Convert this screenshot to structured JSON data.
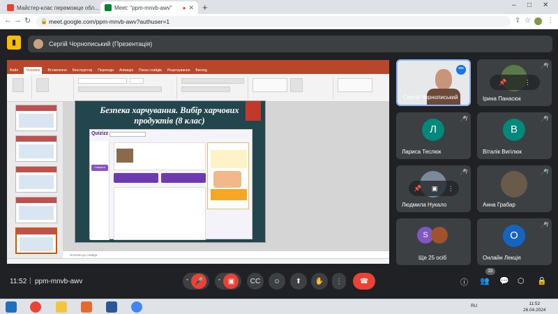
{
  "browser": {
    "tabs": [
      {
        "title": "Майстер-клас переможце обл...",
        "favicon_color": "#ea4335"
      },
      {
        "title": "Meet: \"ppm-mnvb-awv\"",
        "favicon_color": "#00832d",
        "active": true
      }
    ],
    "url": "meet.google.com/ppm-mnvb-awv?authuser=1",
    "window_controls": [
      "–",
      "□",
      "✕"
    ]
  },
  "meet": {
    "presenter_label": "Сергій Чорнописький (Презентація)",
    "clock": "11:52",
    "separator": "|",
    "meeting_code": "ppm-mnvb-awv",
    "participant_count": "33",
    "participants": [
      {
        "name": "Сергій Чорнописький",
        "type": "video",
        "active": true
      },
      {
        "name": "Ірина Панасюк",
        "type": "photo"
      },
      {
        "name": "Лариса Теслюк",
        "type": "letter",
        "letter": "Л",
        "color": "#00897b"
      },
      {
        "name": "Віталік Вигілюк",
        "type": "letter",
        "letter": "В",
        "color": "#00897b"
      },
      {
        "name": "Людмила Нукало",
        "type": "photo-hover"
      },
      {
        "name": "Анна Грабар",
        "type": "photo"
      },
      {
        "name": "Ще 25 осіб",
        "type": "group",
        "letter": "S",
        "color": "#7e57c2"
      },
      {
        "name": "Онлайн Лекція",
        "type": "letter",
        "letter": "О",
        "color": "#1565c0"
      }
    ]
  },
  "slide": {
    "title": "Безпека харчування. Вибір харчових продуктів (8 клас)",
    "quizizz_logo": "Quizizz",
    "create_label": "Створити",
    "notes_placeholder": "Нотатки до слайда"
  }
}
